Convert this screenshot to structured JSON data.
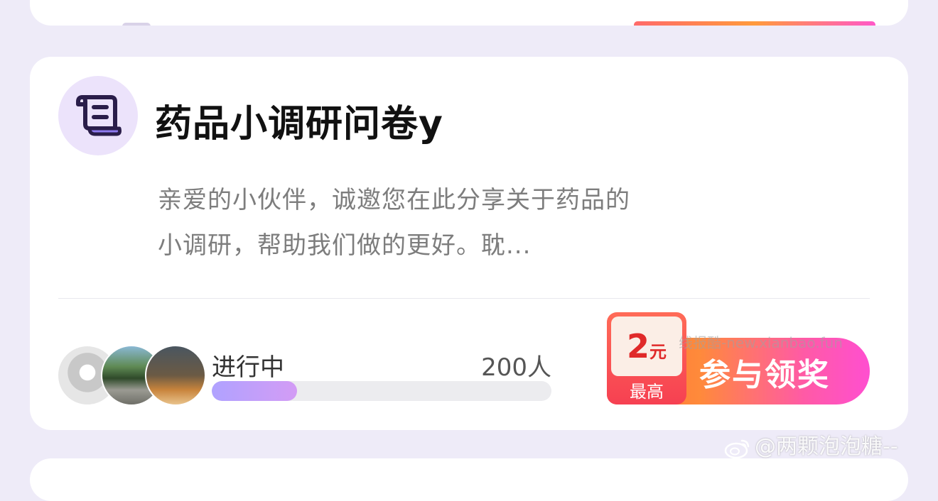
{
  "survey_card": {
    "title": "药品小调研问卷y",
    "description": "亲爱的小伙伴，诚邀您在此分享关于药品的小调研，帮助我们做的更好。耽...",
    "status": "进行中",
    "participants": "200人",
    "progress_fraction": 0.25,
    "reward": {
      "amount": "2",
      "unit": "元",
      "caption": "最高"
    },
    "cta_label": "参与领奖",
    "icon": "scroll-document-icon"
  },
  "watermarks": {
    "site": "线报酷-new.xianbao.fun",
    "weibo": "@两颗泡泡糖--"
  },
  "colors": {
    "page_background": "#eeebf8",
    "card_background": "#ffffff",
    "icon_circle": "#ece3fb",
    "icon_stroke": "#2a1d4a",
    "progress_fill_start": "#b0a2ff",
    "progress_fill_end": "#d39cf5",
    "cta_gradient_start": "#ff6a3d",
    "cta_gradient_end": "#ff4fd0",
    "reward_red": "#e02a2a"
  }
}
